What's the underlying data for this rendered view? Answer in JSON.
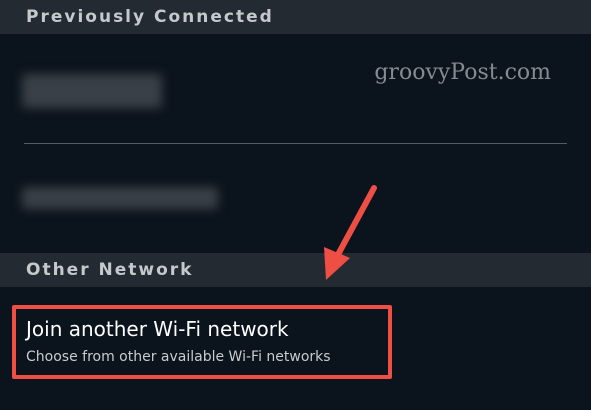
{
  "sections": {
    "previously_connected": "Previously Connected",
    "other_network": "Other Network"
  },
  "join": {
    "title": "Join another Wi-Fi network",
    "subtitle": "Choose from other available Wi-Fi networks"
  },
  "watermark": "groovyPost.com",
  "colors": {
    "background": "#0b131c",
    "section_header": "#232a31",
    "highlight": "#ee4e44"
  }
}
